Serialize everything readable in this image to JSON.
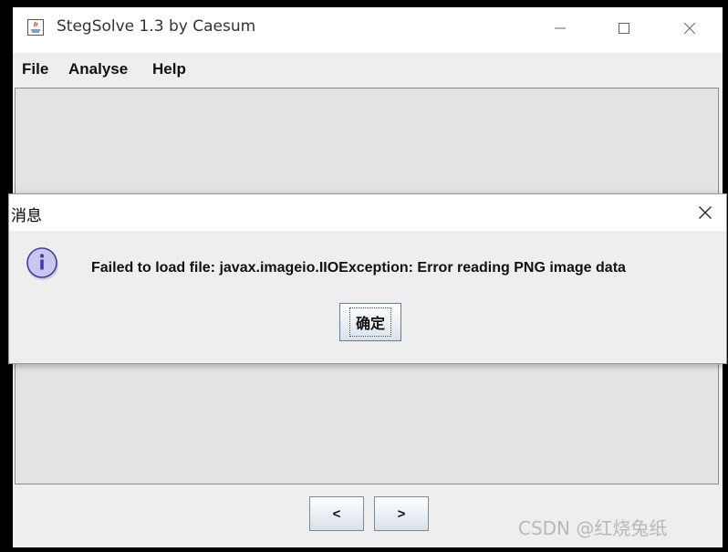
{
  "window": {
    "title": "StegSolve 1.3 by Caesum",
    "icon": "java-app-icon"
  },
  "menubar": {
    "items": [
      "File",
      "Analyse",
      "Help"
    ]
  },
  "navigation": {
    "prev_label": "<",
    "next_label": ">"
  },
  "watermark": "CSDN @红烧兔纸",
  "dialog": {
    "title": "消息",
    "icon": "info-icon",
    "message": "Failed to load file: javax.imageio.IIOException: Error reading PNG image data",
    "ok_label": "确定"
  },
  "colors": {
    "window_bg": "#eeeeee",
    "titlebar_bg": "#ffffff",
    "info_icon_fill": "#c9c6ef",
    "info_icon_stroke": "#3f3fa0"
  }
}
